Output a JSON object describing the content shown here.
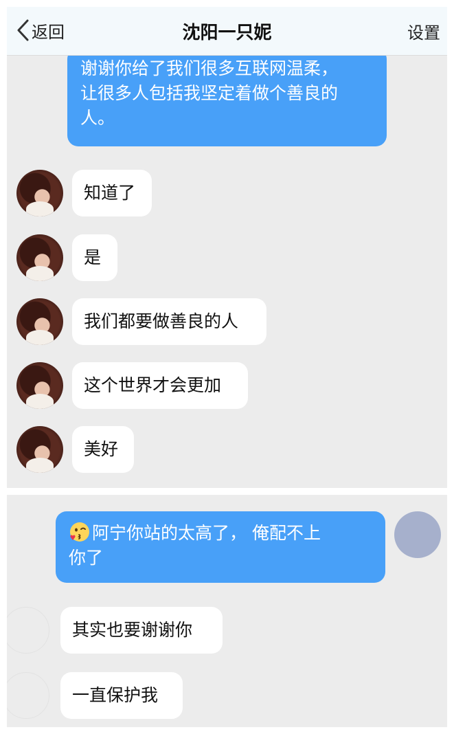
{
  "header": {
    "back_label": "返回",
    "title": "沈阳一只妮",
    "settings_label": "设置"
  },
  "panel1": {
    "messages": [
      {
        "side": "right",
        "text": "谢谢你给了我们很多互联网温柔，\n让很多人包括我坚定着做个善良的\n人。"
      },
      {
        "side": "left",
        "text": "知道了"
      },
      {
        "side": "left",
        "text": "是"
      },
      {
        "side": "left",
        "text": "我们都要做善良的人"
      },
      {
        "side": "left",
        "text": "这个世界才会更加"
      },
      {
        "side": "left",
        "text": "美好"
      }
    ]
  },
  "panel2": {
    "messages": [
      {
        "side": "right",
        "emoji": "kissing-face-with-heart-emoji",
        "text": "阿宁你站的太高了， 俺配不上\n你了"
      },
      {
        "side": "left",
        "text": "其实也要谢谢你"
      },
      {
        "side": "left",
        "text": "一直保护我"
      }
    ]
  },
  "colors": {
    "outgoing_bubble": "#48a0f8",
    "incoming_bubble": "#ffffff",
    "chat_background": "#ececec",
    "header_background": "#f3f9fc"
  }
}
